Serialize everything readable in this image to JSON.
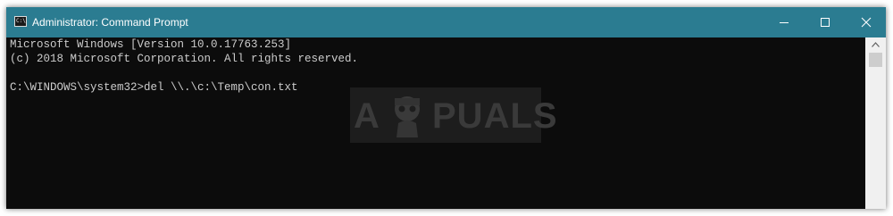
{
  "window": {
    "title": "Administrator: Command Prompt",
    "app_icon_text": "C:\\"
  },
  "titlebar_buttons": [
    {
      "name": "minimize",
      "icon": "minimize-icon"
    },
    {
      "name": "maximize",
      "icon": "maximize-icon"
    },
    {
      "name": "close",
      "icon": "close-icon"
    }
  ],
  "console": {
    "lines": [
      "Microsoft Windows [Version 10.0.17763.253]",
      "(c) 2018 Microsoft Corporation. All rights reserved.",
      "",
      "C:\\WINDOWS\\system32>del \\\\.\\c:\\Temp\\con.txt"
    ]
  },
  "watermark": {
    "letter_a": "A",
    "rest": "PUALS"
  },
  "colors": {
    "titlebar": "#2b7c91",
    "console_bg": "#0c0c0c",
    "console_text": "#cccccc",
    "scrollbar_track": "#f0f0f0",
    "scrollbar_thumb": "#cdcdcd"
  }
}
